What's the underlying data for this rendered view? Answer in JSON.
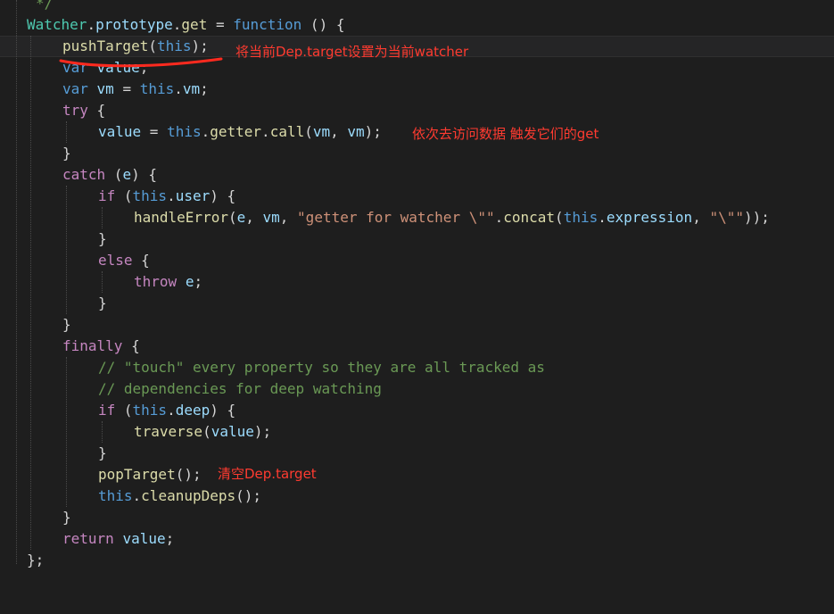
{
  "code": {
    "line0": "*/",
    "watcher": "Watcher",
    "prototype": "prototype",
    "get": "get",
    "function_kw": "function",
    "pushTarget": "pushTarget",
    "this": "this",
    "var": "var",
    "value": "value",
    "vm": "vm",
    "try": "try",
    "getter": "getter",
    "call": "call",
    "catch": "catch",
    "e": "e",
    "if": "if",
    "user": "user",
    "handleError": "handleError",
    "str_getter": "\"getter for watcher \\\"\"",
    "concat": "concat",
    "expression": "expression",
    "str_quote": "\"\\\"\"",
    "else": "else",
    "throw": "throw",
    "finally": "finally",
    "comment1": "// \"touch\" every property so they are all tracked as",
    "comment2": "// dependencies for deep watching",
    "deep": "deep",
    "traverse": "traverse",
    "popTarget": "popTarget",
    "cleanupDeps": "cleanupDeps",
    "return": "return"
  },
  "annotations": {
    "push_note": "将当前Dep.target设置为当前watcher",
    "getter_note": "依次去访问数据 触发它们的get",
    "pop_note": "清空Dep.target"
  },
  "colors": {
    "background": "#1e1e1e",
    "annotation": "#ff3b30",
    "keyword": "#569cd6",
    "function": "#dcdcaa",
    "string": "#ce9178",
    "comment": "#6a9955"
  }
}
